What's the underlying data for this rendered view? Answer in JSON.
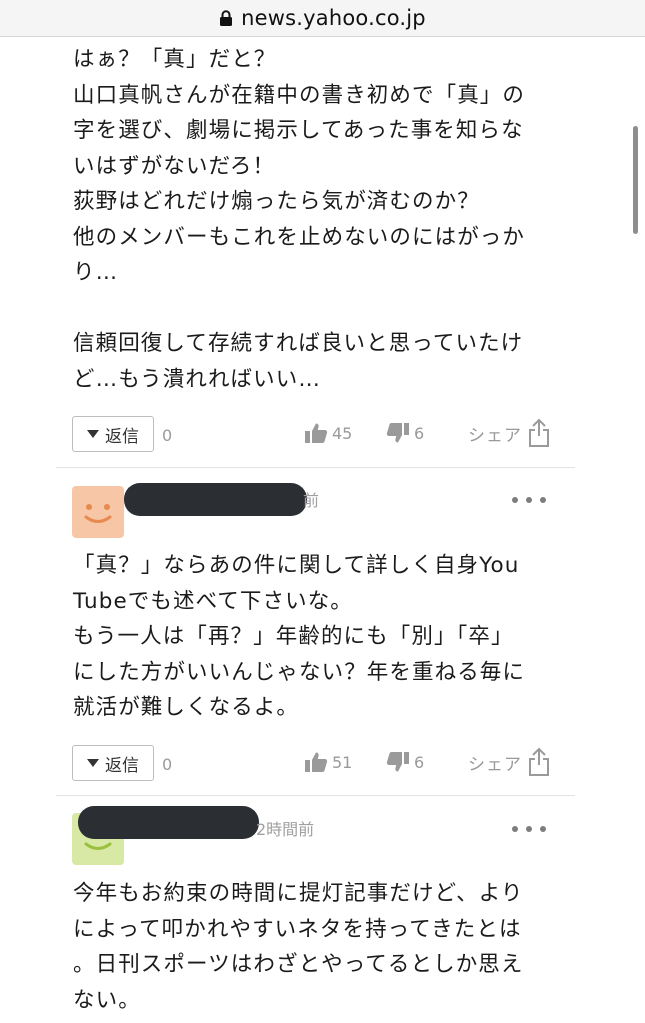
{
  "browser": {
    "url": "news.yahoo.co.jp"
  },
  "comments": [
    {
      "lines": [
        "はぁ？「真」だと？",
        "山口真帆さんが在籍中の書き初めで「真」の",
        "字を選び、劇場に掲示してあった事を知らな",
        "いはずがないだろ！",
        "荻野はどれだけ煽ったら気が済むのか？",
        "他のメンバーもこれを止めないのにはがっか",
        "り…",
        "",
        "信頼回復して存続すれば良いと思っていたけ",
        "ど…もう潰れればいい…"
      ],
      "reply_label": "返信",
      "reply_count": "0",
      "likes": "45",
      "dislikes": "6",
      "share_label": "シェア"
    },
    {
      "timestamp": "前",
      "lines": [
        "「真？」ならあの件に関して詳しく自身You",
        "Tubeでも述べて下さいな。",
        "もう一人は「再？」年齢的にも「別」「卒」",
        "にした方がいいんじゃない？年を重ねる毎に",
        "就活が難しくなるよ。"
      ],
      "reply_label": "返信",
      "reply_count": "0",
      "likes": "51",
      "dislikes": "6",
      "share_label": "シェア"
    },
    {
      "timestamp": "2時間前",
      "lines": [
        "今年もお約束の時間に提灯記事だけど、より",
        "によって叩かれやすいネタを持ってきたとは",
        "。日刊スポーツはわざとやってるとしか思え",
        "ない。"
      ]
    }
  ],
  "icons": {
    "lock": "lock-icon",
    "thumbs_up": "thumbs-up-icon",
    "thumbs_down": "thumbs-down-icon",
    "share": "share-icon",
    "more": "more-icon"
  },
  "colors": {
    "avatar_orange": "#f6c6a6",
    "avatar_orange_face": "#e8894f",
    "avatar_green": "#d7e9a4",
    "avatar_green_face": "#9bbf3e",
    "redaction": "#2b2f33"
  }
}
